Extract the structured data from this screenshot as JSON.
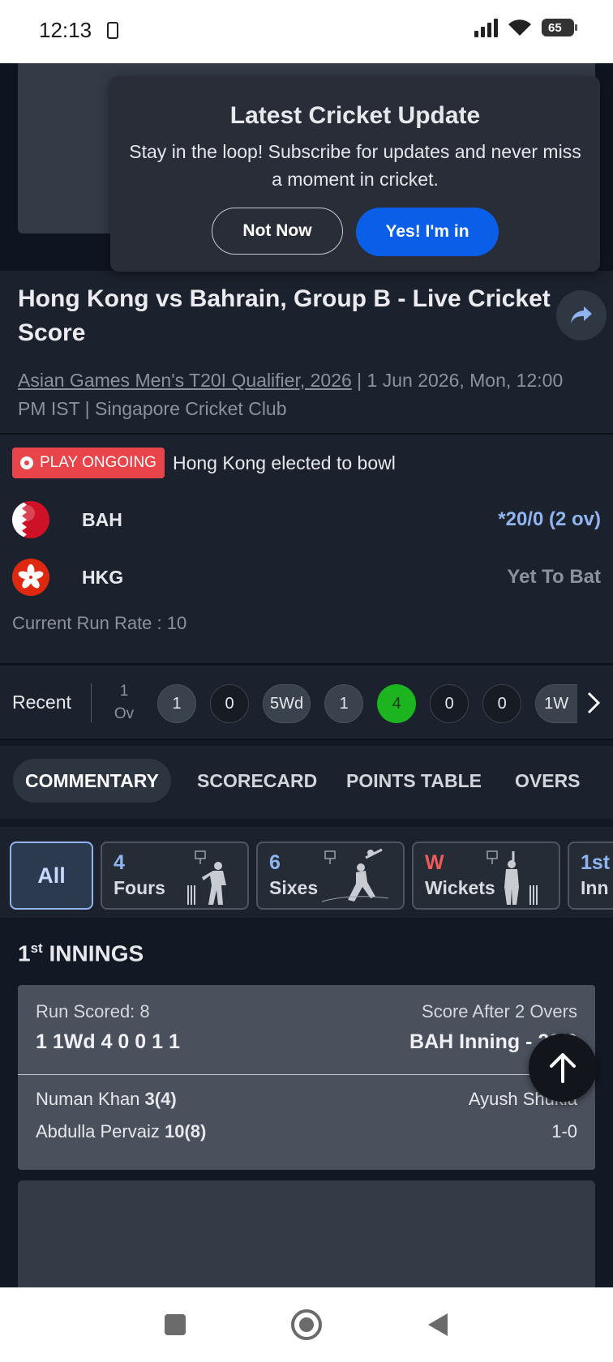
{
  "status_bar": {
    "time": "12:13",
    "battery": "65"
  },
  "popup": {
    "title": "Latest Cricket Update",
    "text": "Stay in the loop! Subscribe for updates and never miss a moment in cricket.",
    "not_now": "Not Now",
    "yes": "Yes! I'm in"
  },
  "match": {
    "title": "Hong Kong vs Bahrain, Group B - Live Cricket Score",
    "series": "Asian Games Men's T20I Qualifier, 2026",
    "meta_rest": " | 1 Jun 2026, Mon, 12:00 PM IST | Singapore Cricket Club",
    "status_badge": "PLAY ONGOING",
    "toss": "Hong Kong elected to bowl",
    "teams": [
      {
        "name": "BAH",
        "score": "*20/0 (2 ov)",
        "score_color": "#8fb4ef"
      },
      {
        "name": "HKG",
        "score": "Yet To Bat",
        "score_color": "#8c929c"
      }
    ],
    "crr": "Current Run Rate : 10"
  },
  "recent": {
    "label": "Recent",
    "over_num": "1",
    "over_unit": "Ov",
    "balls": [
      "1",
      "0",
      "5Wd",
      "1",
      "4",
      "0",
      "0",
      "1W"
    ]
  },
  "tabs": [
    "COMMENTARY",
    "SCORECARD",
    "POINTS TABLE",
    "OVERS"
  ],
  "filters": {
    "all": "All",
    "fours_count": "4",
    "fours_label": "Fours",
    "sixes_count": "6",
    "sixes_label": "Sixes",
    "wickets_count": "W",
    "wickets_label": "Wickets",
    "innings_count": "1st",
    "innings_label": "Inn"
  },
  "innings": {
    "num": "1",
    "sup": "st",
    "label": "INNINGS"
  },
  "over_card": {
    "runs_label": "Run Scored: 8",
    "balls_seq": "1 1Wd 4 0 0 1 1",
    "score_after_label": "Score After 2 Overs",
    "score_after_value": "BAH Inning - 20/0",
    "batter1_name": "Numan Khan",
    "batter1_score": "3(4)",
    "batter2_name": "Abdulla Pervaiz",
    "batter2_score": "10(8)",
    "bowler_name": "Ayush Shukla",
    "bowler_figures": "1-0"
  },
  "colors": {
    "accent": "#0b5ee8",
    "live": "#e8444a",
    "boundary": "#1db51f",
    "score_blue": "#8fb4ef"
  }
}
